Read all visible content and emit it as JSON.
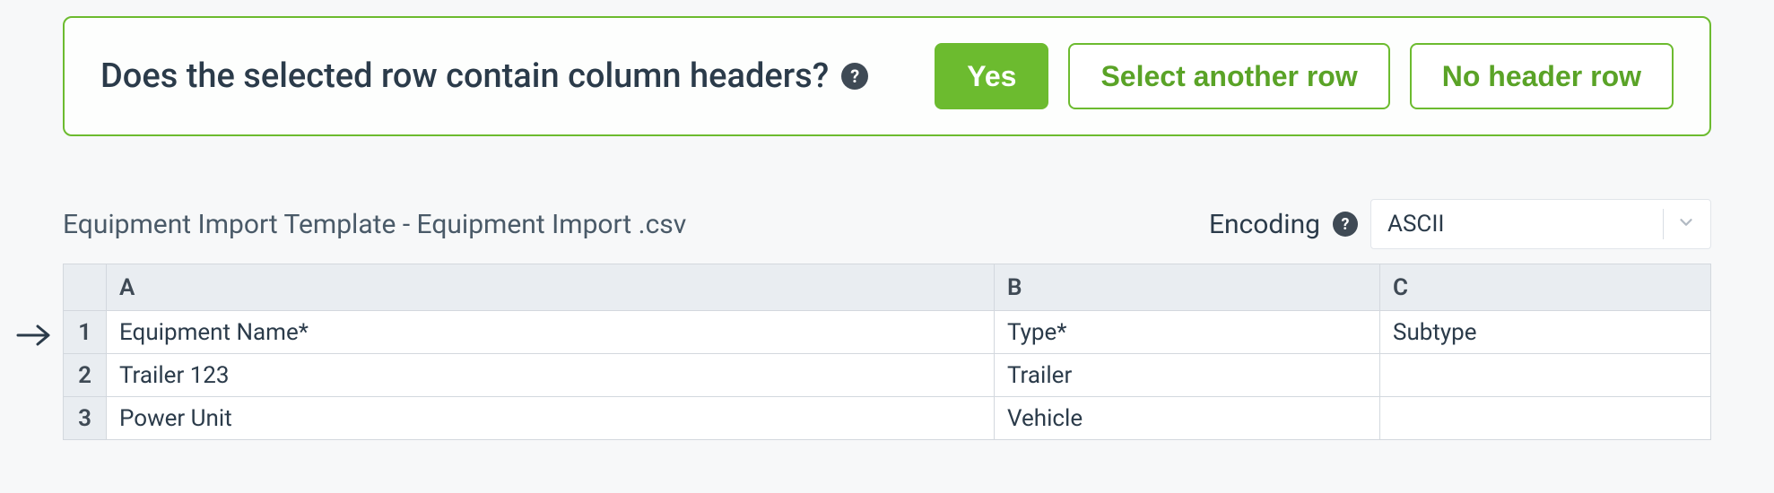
{
  "prompt": {
    "question": "Does the selected row contain column headers?",
    "help_glyph": "?",
    "yes_label": "Yes",
    "select_another_label": "Select another row",
    "no_header_label": "No header row"
  },
  "file": {
    "name": "Equipment Import Template - Equipment Import .csv"
  },
  "encoding": {
    "label": "Encoding",
    "help_glyph": "?",
    "value": "ASCII"
  },
  "table": {
    "columns": [
      "A",
      "B",
      "C"
    ],
    "rows": [
      {
        "num": "1",
        "cells": [
          "Equipment Name*",
          "Type*",
          "Subtype"
        ]
      },
      {
        "num": "2",
        "cells": [
          "Trailer 123",
          "Trailer",
          ""
        ]
      },
      {
        "num": "3",
        "cells": [
          "Power Unit",
          "Vehicle",
          ""
        ]
      }
    ]
  }
}
